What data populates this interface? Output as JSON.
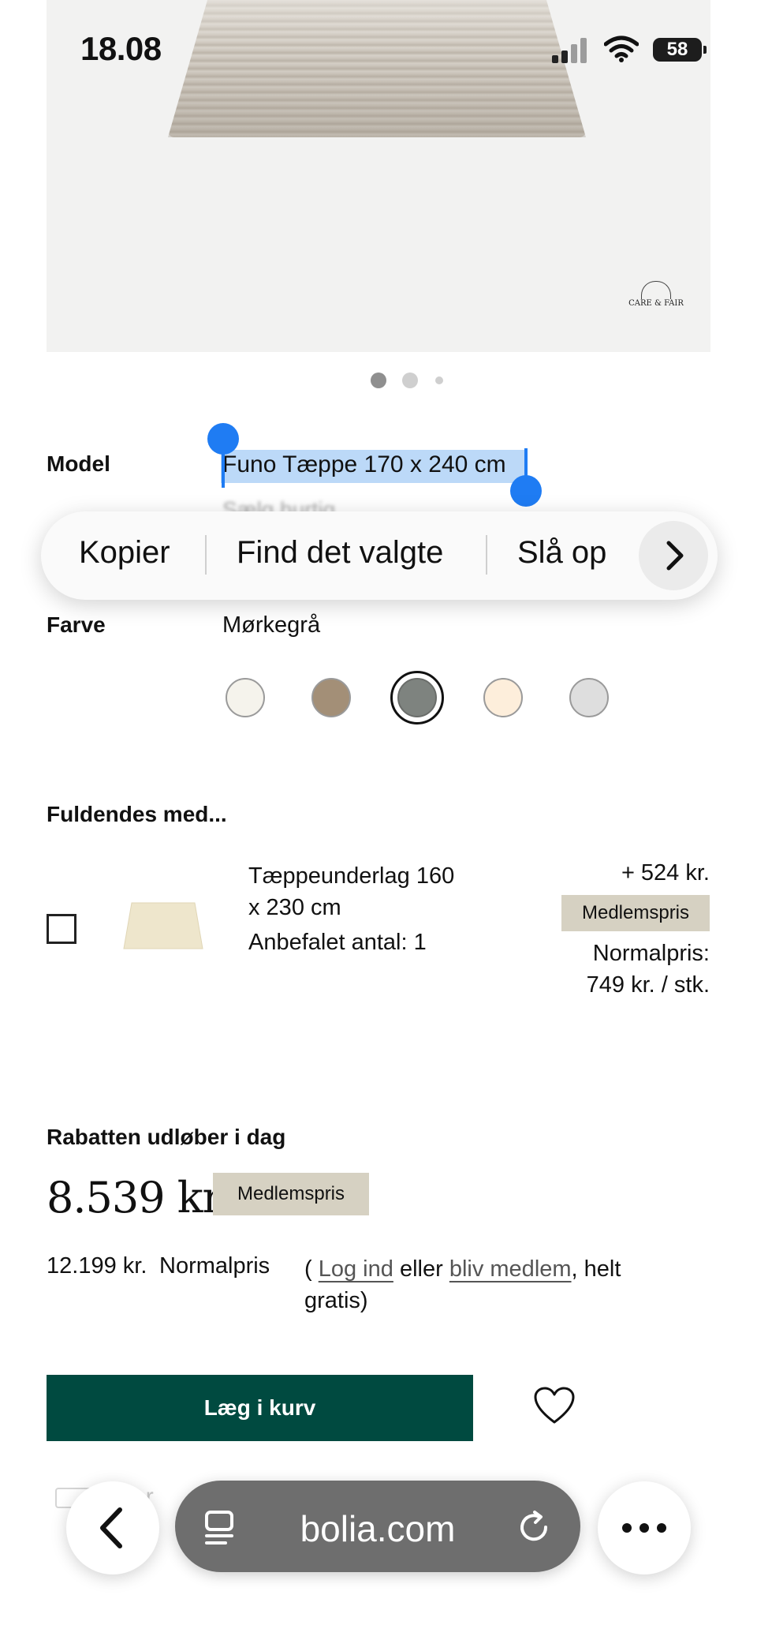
{
  "status_bar": {
    "time": "18.08",
    "battery": "58"
  },
  "product_image": {
    "brand_logo": "CARE & FAIR"
  },
  "gallery": {
    "page_count": 3,
    "active_index": 0
  },
  "product": {
    "model_label": "Model",
    "model_value": "Funo Tæppe 170 x 240 cm",
    "obscured_text": "Sælg hurtig",
    "color_label": "Farve",
    "color_value": "Mørkegrå",
    "swatches": [
      {
        "name": "cream",
        "color": "#f5f3ec"
      },
      {
        "name": "brown",
        "color": "#a38f77"
      },
      {
        "name": "dark-grey",
        "color": "#7e837f",
        "selected": true
      },
      {
        "name": "beige",
        "color": "#fdeedb"
      },
      {
        "name": "light-grey",
        "color": "#dedede"
      }
    ]
  },
  "context_menu": {
    "copy": "Kopier",
    "find_selected": "Find det valgte",
    "look_up": "Slå op",
    "next_icon": "chevron-right-icon"
  },
  "complete_with": {
    "heading": "Fuldendes med...",
    "item": {
      "title_line1": "Tæppeunderlag 160",
      "title_line2": "x 230 cm",
      "recommended": "Anbefalet antal: 1",
      "price": "+ 524 kr.",
      "member_badge": "Medlemspris",
      "normal_label": "Normalpris:",
      "normal_price": "749 kr. / stk.",
      "checked": false
    }
  },
  "pricing": {
    "discount_heading": "Rabatten udløber i dag",
    "price": "8.539 kr.",
    "member_badge": "Medlemspris",
    "normal_price": "12.199 kr.",
    "normal_label": "Normalpris",
    "paren_open": "(",
    "login_link": "Log ind",
    "or_text": "eller",
    "member_link": "bliv medlem",
    "suffix_1": ", helt",
    "suffix_2": "gratis)"
  },
  "actions": {
    "add_to_cart": "Læg i kurv",
    "favorite_icon": "heart-icon"
  },
  "browser": {
    "url": "bolia.com",
    "ghost_text": "Ber",
    "back_icon": "chevron-left-icon",
    "tabs_icon": "tabs-icon",
    "reload_icon": "reload-icon",
    "more_icon": "more-icon"
  },
  "colors": {
    "accent_green": "#004a40",
    "selection_blue": "#1f7cf3",
    "selection_fill": "#bcd9f8",
    "badge": "#d6d1c2"
  }
}
